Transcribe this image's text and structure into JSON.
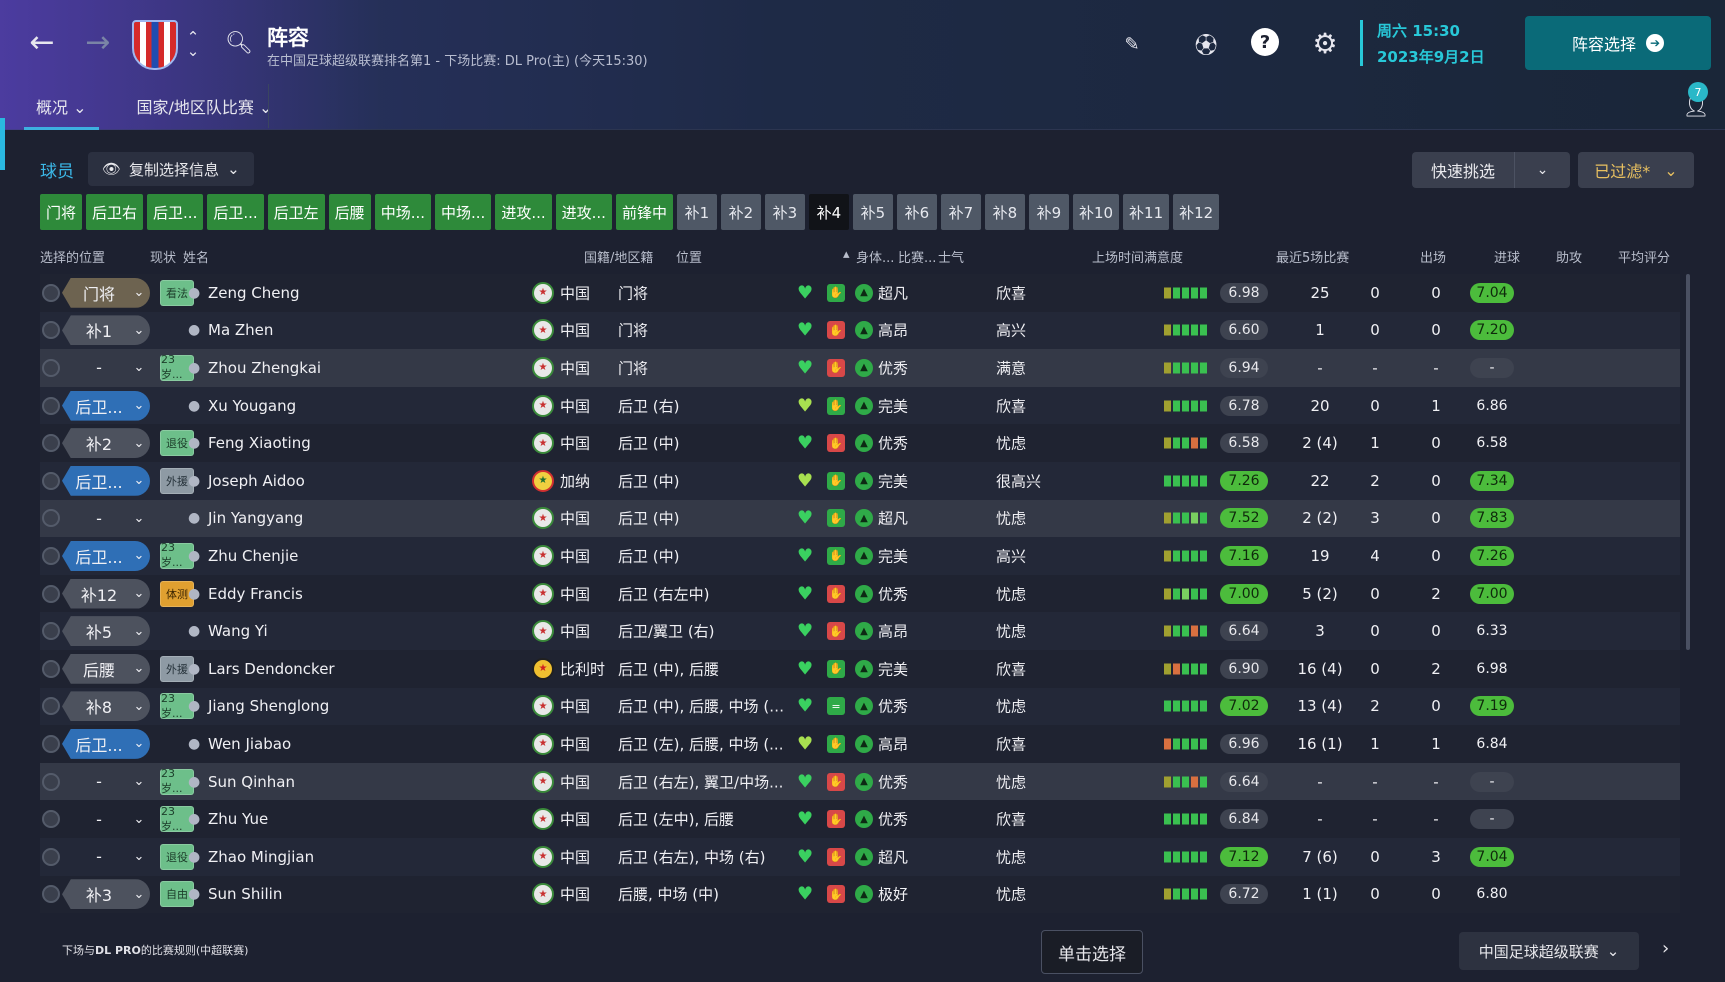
{
  "header": {
    "title": "阵容",
    "subtitle": "在中国足球超级联赛排名第1 - 下场比赛: DL Pro(主) (今天15:30)",
    "date_line1": "周六 15:30",
    "date_line2": "2023年9月2日",
    "lineup_button": "阵容选择",
    "notification_count": "7"
  },
  "tabs": [
    {
      "label": "概况"
    },
    {
      "label": "国家/地区队比赛"
    }
  ],
  "panel": {
    "label": "球员",
    "copy_button": "复制选择信息",
    "quick_pick": "快速挑选",
    "filtered": "已过滤*"
  },
  "position_tabs": [
    "门将",
    "后卫右",
    "后卫...",
    "后卫...",
    "后卫左",
    "后腰",
    "中场...",
    "中场...",
    "进攻...",
    "进攻...",
    "前锋中",
    "补1",
    "补2",
    "补3",
    "补4",
    "补5",
    "补6",
    "补7",
    "补8",
    "补9",
    "补10",
    "补11",
    "补12"
  ],
  "columns": {
    "selected_pos": "选择的位置",
    "status": "现状",
    "name": "姓名",
    "nationality": "国籍/地区籍",
    "position": "位置",
    "fitness": "身体...",
    "match": "比赛...",
    "morale": "士气",
    "playtime": "上场时间满意度",
    "last5": "最近5场比赛",
    "apps": "出场",
    "goals": "进球",
    "assists": "助攻",
    "avg": "平均评分"
  },
  "players": [
    {
      "sel": "门将",
      "status": "看法",
      "name": "Zeng Cheng",
      "nat": "中国",
      "pos": "门将",
      "morale": "超凡",
      "sat": "欣喜",
      "last": "6.98",
      "apps": "25",
      "goals": "0",
      "assists": "0",
      "avg": "7.04"
    },
    {
      "sel": "补1",
      "status": "",
      "name": "Ma Zhen",
      "nat": "中国",
      "pos": "门将",
      "morale": "高昂",
      "sat": "高兴",
      "last": "6.60",
      "apps": "1",
      "goals": "0",
      "assists": "0",
      "avg": "7.20"
    },
    {
      "sel": "-",
      "status": "23岁...",
      "name": "Zhou Zhengkai",
      "nat": "中国",
      "pos": "门将",
      "morale": "优秀",
      "sat": "满意",
      "last": "6.94",
      "apps": "-",
      "goals": "-",
      "assists": "-",
      "avg": "-"
    },
    {
      "sel": "后卫...",
      "status": "",
      "name": "Xu Yougang",
      "nat": "中国",
      "pos": "后卫 (右)",
      "morale": "完美",
      "sat": "欣喜",
      "last": "6.78",
      "apps": "20",
      "goals": "0",
      "assists": "1",
      "avg": "6.86"
    },
    {
      "sel": "补2",
      "status": "退役",
      "name": "Feng Xiaoting",
      "nat": "中国",
      "pos": "后卫 (中)",
      "morale": "优秀",
      "sat": "忧虑",
      "last": "6.58",
      "apps": "2 (4)",
      "goals": "1",
      "assists": "0",
      "avg": "6.58"
    },
    {
      "sel": "后卫...",
      "status": "外援",
      "name": "Joseph Aidoo",
      "nat": "加纳",
      "pos": "后卫 (中)",
      "morale": "完美",
      "sat": "很高兴",
      "last": "7.26",
      "apps": "22",
      "goals": "2",
      "assists": "0",
      "avg": "7.34"
    },
    {
      "sel": "-",
      "status": "",
      "name": "Jin Yangyang",
      "nat": "中国",
      "pos": "后卫 (中)",
      "morale": "超凡",
      "sat": "忧虑",
      "last": "7.52",
      "apps": "2 (2)",
      "goals": "3",
      "assists": "0",
      "avg": "7.83"
    },
    {
      "sel": "后卫...",
      "status": "23岁...",
      "name": "Zhu Chenjie",
      "nat": "中国",
      "pos": "后卫 (中)",
      "morale": "完美",
      "sat": "高兴",
      "last": "7.16",
      "apps": "19",
      "goals": "4",
      "assists": "0",
      "avg": "7.26"
    },
    {
      "sel": "补12",
      "status": "体测",
      "name": "Eddy Francis",
      "nat": "中国",
      "pos": "后卫 (右左中)",
      "morale": "优秀",
      "sat": "忧虑",
      "last": "7.00",
      "apps": "5 (2)",
      "goals": "0",
      "assists": "2",
      "avg": "7.00"
    },
    {
      "sel": "补5",
      "status": "",
      "name": "Wang Yi",
      "nat": "中国",
      "pos": "后卫/翼卫 (右)",
      "morale": "高昂",
      "sat": "忧虑",
      "last": "6.64",
      "apps": "3",
      "goals": "0",
      "assists": "0",
      "avg": "6.33"
    },
    {
      "sel": "后腰",
      "status": "外援",
      "name": "Lars Dendoncker",
      "nat": "比利时",
      "pos": "后卫 (中), 后腰",
      "morale": "完美",
      "sat": "欣喜",
      "last": "6.90",
      "apps": "16 (4)",
      "goals": "0",
      "assists": "2",
      "avg": "6.98"
    },
    {
      "sel": "补8",
      "status": "23岁...",
      "name": "Jiang Shenglong",
      "nat": "中国",
      "pos": "后卫 (中), 后腰, 中场 (中)",
      "morale": "优秀",
      "sat": "忧虑",
      "last": "7.02",
      "apps": "13 (4)",
      "goals": "2",
      "assists": "0",
      "avg": "7.19"
    },
    {
      "sel": "后卫...",
      "status": "",
      "name": "Wen Jiabao",
      "nat": "中国",
      "pos": "后卫 (左), 后腰, 中场 (...",
      "morale": "高昂",
      "sat": "欣喜",
      "last": "6.96",
      "apps": "16 (1)",
      "goals": "1",
      "assists": "1",
      "avg": "6.84"
    },
    {
      "sel": "-",
      "status": "23岁...",
      "name": "Sun Qinhan",
      "nat": "中国",
      "pos": "后卫 (右左), 翼卫/中场...",
      "morale": "优秀",
      "sat": "忧虑",
      "last": "6.64",
      "apps": "-",
      "goals": "-",
      "assists": "-",
      "avg": "-"
    },
    {
      "sel": "-",
      "status": "23岁...",
      "name": "Zhu Yue",
      "nat": "中国",
      "pos": "后卫 (左中), 后腰",
      "morale": "优秀",
      "sat": "欣喜",
      "last": "6.84",
      "apps": "-",
      "goals": "-",
      "assists": "-",
      "avg": "-"
    },
    {
      "sel": "-",
      "status": "退役",
      "name": "Zhao Mingjian",
      "nat": "中国",
      "pos": "后卫 (右左), 中场 (右)",
      "morale": "超凡",
      "sat": "忧虑",
      "last": "7.12",
      "apps": "7 (6)",
      "goals": "0",
      "assists": "3",
      "avg": "7.04"
    },
    {
      "sel": "补3",
      "status": "自由",
      "name": "Sun Shilin",
      "nat": "中国",
      "pos": "后腰, 中场 (中)",
      "morale": "极好",
      "sat": "忧虑",
      "last": "6.72",
      "apps": "1 (1)",
      "goals": "0",
      "assists": "0",
      "avg": "6.80"
    }
  ],
  "footer": {
    "rule_prefix": "下场与",
    "rule_bold": "DL PRO",
    "rule_suffix": "的比赛规则(中超联赛)",
    "click_select": "单击选择",
    "league": "中国足球超级联赛"
  }
}
